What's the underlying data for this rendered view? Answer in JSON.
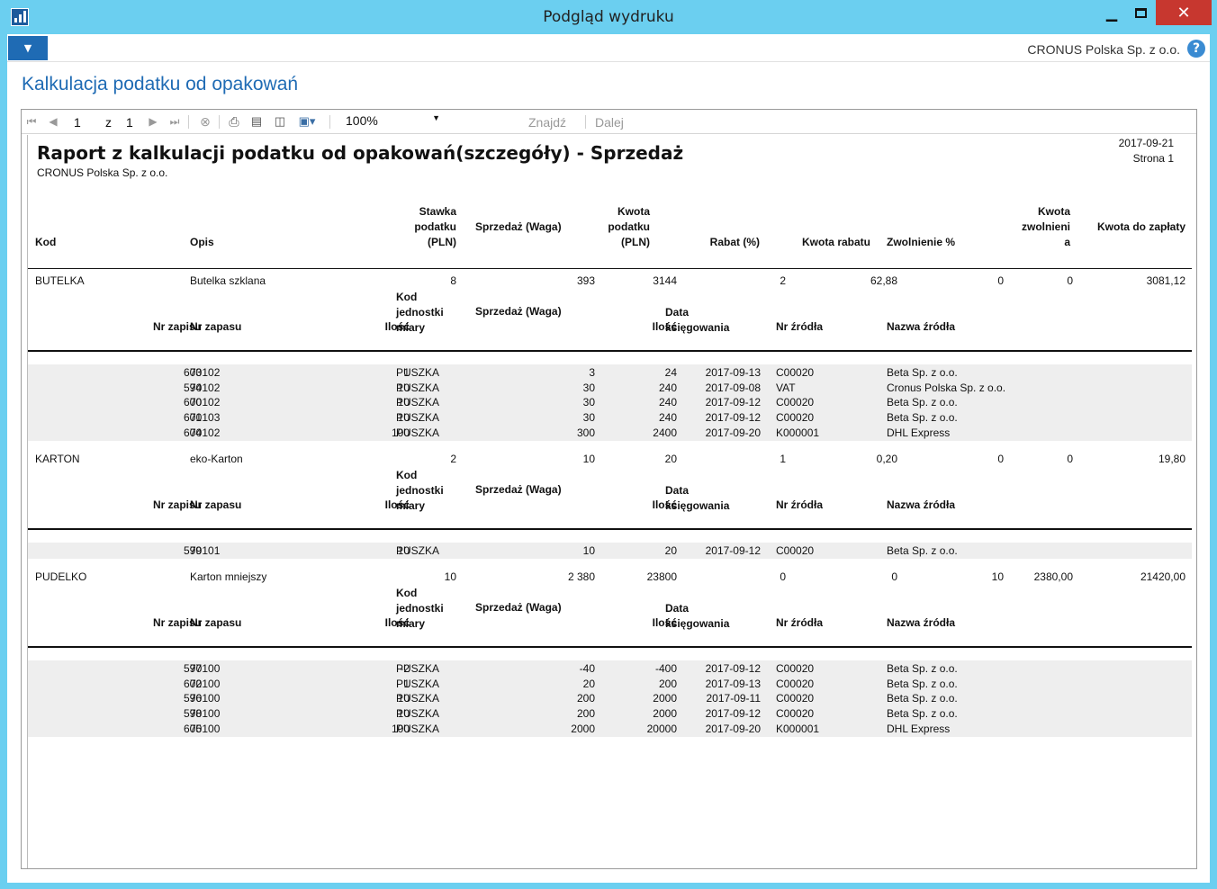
{
  "window": {
    "title": "Podgląd wydruku"
  },
  "cmdbar": {
    "company": "CRONUS Polska Sp. z o.o.",
    "help": "?"
  },
  "page_title": "Kalkulacja podatku od opakowań",
  "toolbar": {
    "page_current": "1",
    "page_of": "z",
    "page_total": "1",
    "zoom": "100%",
    "find": "Znajdź",
    "next": "Dalej"
  },
  "report": {
    "title": "Raport z kalkulacji podatku od opakowań(szczegóły) - Sprzedaż",
    "company": "CRONUS Polska Sp. z o.o.",
    "date": "2017-09-21",
    "page": "Strona 1",
    "header": {
      "kod": "Kod",
      "opis": "Opis",
      "stawka": "Stawka\npodatku\n(PLN)",
      "sprzedaz": "Sprzedaż (Waga)",
      "kwota_podatku": "Kwota\npodatku\n(PLN)",
      "rabat_pct": "Rabat (%)",
      "kwota_rabatu": "Kwota rabatu",
      "zwolnienie": "Zwolnienie %",
      "kwota_zwolnienia": "Kwota\nzwolnieni\na",
      "kwota_do_zaplaty": "Kwota do zapłaty"
    },
    "sub_header": {
      "nr_zapisu": "Nr zapisu",
      "nr_zapasu": "Nr zapasu",
      "ilosc": "Ilość",
      "kod_jm": "Kod\njednostki\nmiary",
      "sprzedaz": "Sprzedaż (Waga)",
      "ilosc2": "Ilość",
      "data": "Data\nksięgowania",
      "nr_zrodla": "Nr źródła",
      "nazwa_zrodla": "Nazwa źródła"
    },
    "groups": [
      {
        "kod": "BUTELKA",
        "opis": "Butelka szklana",
        "stawka": "8",
        "sprzedaz": "393",
        "kwota_podatku": "3144",
        "rabat_pct": "2",
        "kwota_rabatu": "62,88",
        "zwolnienie": "0",
        "kwota_zwolnienia": "0",
        "do_zaplaty": "3081,12",
        "rows": [
          [
            "603",
            "70102",
            "1",
            "PUSZKA",
            "3",
            "24",
            "2017-09-13",
            "C00020",
            "Beta Sp. z o.o."
          ],
          [
            "594",
            "70102",
            "10",
            "PUSZKA",
            "30",
            "240",
            "2017-09-08",
            "VAT",
            "Cronus Polska Sp. z o.o."
          ],
          [
            "600",
            "70102",
            "10",
            "PUSZKA",
            "30",
            "240",
            "2017-09-12",
            "C00020",
            "Beta Sp. z o.o."
          ],
          [
            "601",
            "70103",
            "10",
            "PUSZKA",
            "30",
            "240",
            "2017-09-12",
            "C00020",
            "Beta Sp. z o.o."
          ],
          [
            "604",
            "70102",
            "100",
            "PUSZKA",
            "300",
            "2400",
            "2017-09-20",
            "K000001",
            "DHL Express"
          ]
        ]
      },
      {
        "kod": "KARTON",
        "opis": "eko-Karton",
        "stawka": "2",
        "sprzedaz": "10",
        "kwota_podatku": "20",
        "rabat_pct": "1",
        "kwota_rabatu": "0,20",
        "zwolnienie": "0",
        "kwota_zwolnienia": "0",
        "do_zaplaty": "19,80",
        "rows": [
          [
            "599",
            "70101",
            "10",
            "PUSZKA",
            "10",
            "20",
            "2017-09-12",
            "C00020",
            "Beta Sp. z o.o."
          ]
        ]
      },
      {
        "kod": "PUDELKO",
        "opis": "Karton mniejszy",
        "stawka": "10",
        "sprzedaz": "2 380",
        "kwota_podatku": "23800",
        "rabat_pct": "0",
        "kwota_rabatu": "0",
        "zwolnienie": "10",
        "kwota_zwolnienia": "2380,00",
        "do_zaplaty": "21420,00",
        "rows": [
          [
            "597",
            "70100",
            "-2",
            "PUSZKA",
            "-40",
            "-400",
            "2017-09-12",
            "C00020",
            "Beta Sp. z o.o."
          ],
          [
            "602",
            "70100",
            "1",
            "PUSZKA",
            "20",
            "200",
            "2017-09-13",
            "C00020",
            "Beta Sp. z o.o."
          ],
          [
            "596",
            "70100",
            "10",
            "PUSZKA",
            "200",
            "2000",
            "2017-09-11",
            "C00020",
            "Beta Sp. z o.o."
          ],
          [
            "598",
            "70100",
            "10",
            "PUSZKA",
            "200",
            "2000",
            "2017-09-12",
            "C00020",
            "Beta Sp. z o.o."
          ],
          [
            "605",
            "70100",
            "100",
            "PUSZKA",
            "2000",
            "20000",
            "2017-09-20",
            "K000001",
            "DHL Express"
          ]
        ]
      }
    ]
  }
}
